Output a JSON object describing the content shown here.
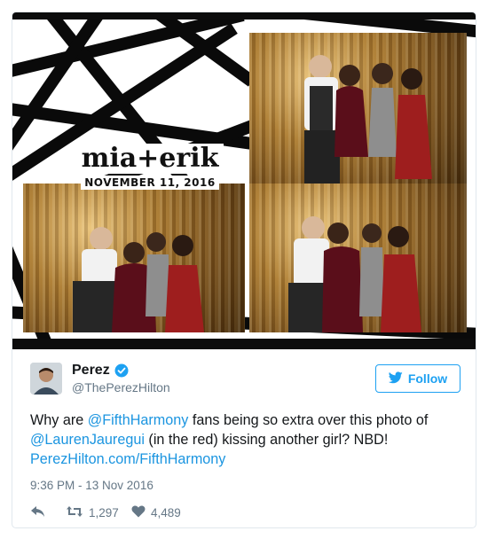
{
  "media": {
    "logo_names": "mia+erik",
    "logo_date": "NOVEMBER 11, 2016"
  },
  "tweet": {
    "display_name": "Perez",
    "handle": "@ThePerezHilton",
    "follow_label": "Follow",
    "text_parts": {
      "p1": "Why are ",
      "mention1": "@FifthHarmony",
      "p2": " fans being so extra over this photo of ",
      "mention2": "@LaurenJauregui",
      "p3": " (in the red) kissing another girl? NBD! ",
      "link": "PerezHilton.com/FifthHarmony"
    },
    "timestamp": "9:36 PM - 13 Nov 2016",
    "retweets": "1,297",
    "likes": "4,489"
  },
  "icons": {
    "verified": "verified-badge-icon",
    "follow": "twitter-bird-icon",
    "reply": "reply-icon",
    "retweet": "retweet-icon",
    "like": "heart-icon"
  },
  "colors": {
    "accent": "#1da1f2",
    "link": "#1b95e0",
    "muted": "#657786",
    "gold": "#c9a158"
  }
}
